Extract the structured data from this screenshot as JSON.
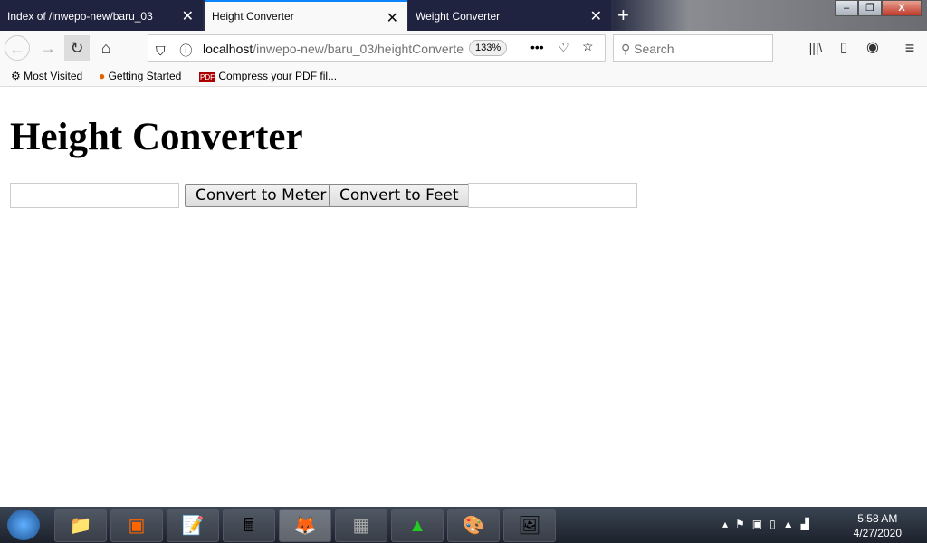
{
  "tabs": [
    {
      "label": "Index of /inwepo-new/baru_03"
    },
    {
      "label": "Height Converter"
    },
    {
      "label": "Weight Converter"
    }
  ],
  "url": {
    "host": "localhost",
    "path": "/inwepo-new/baru_03/heightConverte",
    "zoom": "133%"
  },
  "search_placeholder": "Search",
  "bookmarks": [
    "Most Visited",
    "Getting Started",
    "Compress your PDF fil..."
  ],
  "page": {
    "title": "Height Converter",
    "btn_meter": "Convert to Meter",
    "btn_feet": "Convert to Feet",
    "input_value": "",
    "output_value": ""
  },
  "taskbar": {
    "time": "5:58 AM",
    "date": "4/27/2020"
  }
}
